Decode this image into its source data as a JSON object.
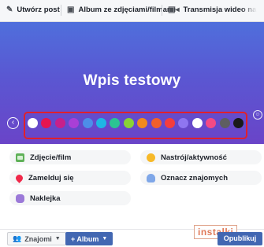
{
  "tabs": [
    {
      "icon": "pencil-icon",
      "label": "Utwórz post"
    },
    {
      "icon": "album-icon",
      "label": "Album ze zdjęciami/filmami"
    },
    {
      "icon": "live-video-icon",
      "label": "Transmisja wideo na żywo"
    }
  ],
  "composer": {
    "post_text": "Wpis testowy",
    "background_colors": [
      "#ffffff",
      "#e5154f",
      "#c7208a",
      "#a93fd6",
      "#4d8ee8",
      "#1fb6e4",
      "#2bc493",
      "#89d335",
      "#f08a1e",
      "#f05f2c",
      "#f43d3d",
      "#8f76f0",
      "#ffffff",
      "#f34a85",
      "#5e5e61",
      "#1a1a1a"
    ],
    "selected_index": 12
  },
  "options": [
    {
      "icon": "photo-icon",
      "label": "Zdjęcie/film"
    },
    {
      "icon": "feeling-icon",
      "label": "Nastrój/aktywność"
    },
    {
      "icon": "location-pin-icon",
      "label": "Zamelduj się"
    },
    {
      "icon": "tag-friends-icon",
      "label": "Oznacz znajomych"
    },
    {
      "icon": "sticker-icon",
      "label": "Naklejka"
    }
  ],
  "footer": {
    "audience_label": "Znajomi",
    "album_label": "+ Album",
    "publish_label": "Opublikuj"
  },
  "watermark": "instalki"
}
